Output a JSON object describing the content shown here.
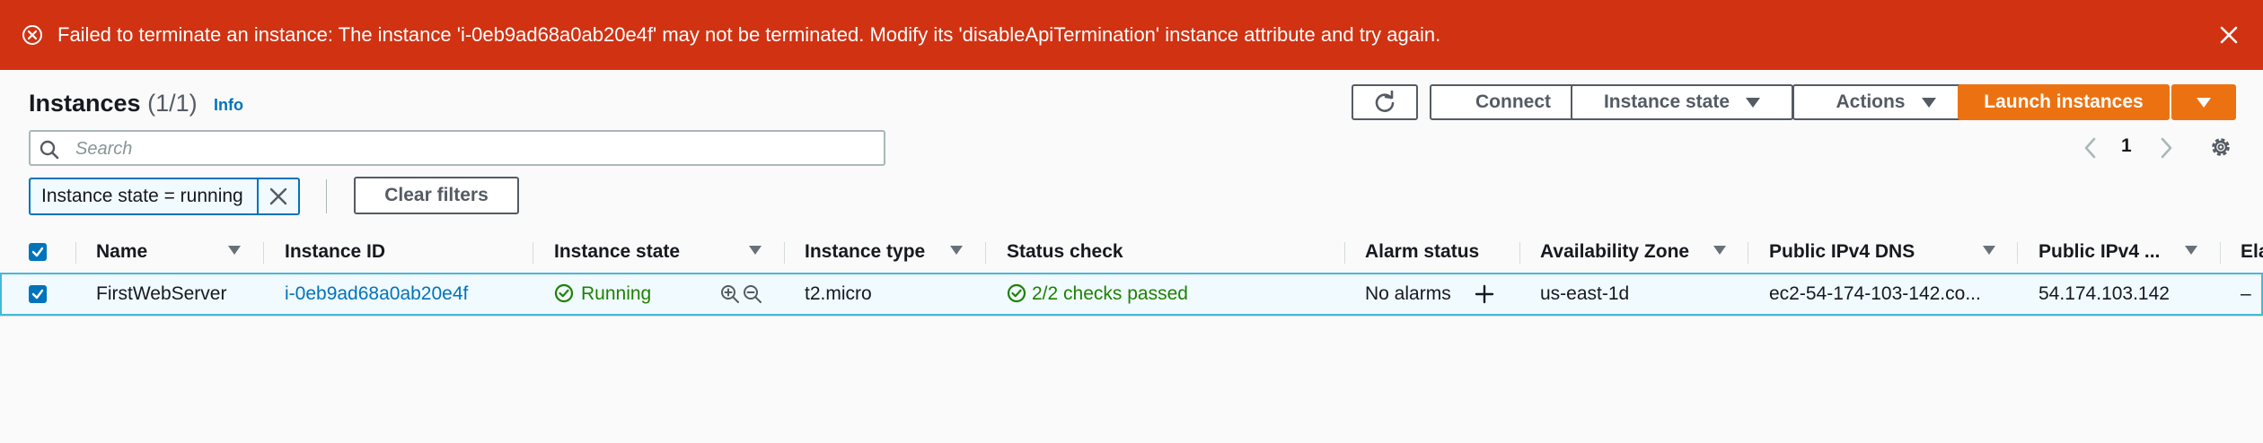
{
  "alert": {
    "message": "Failed to terminate an instance: The instance 'i-0eb9ad68a0ab20e4f' may not be terminated. Modify its 'disableApiTermination' instance attribute and try again.",
    "icon": "error-icon",
    "color": "#d13212"
  },
  "header": {
    "title": "Instances",
    "count": "(1/1)",
    "info": "Info"
  },
  "toolbar": {
    "connect": "Connect",
    "instance_state": "Instance state",
    "actions": "Actions",
    "launch": "Launch instances"
  },
  "search": {
    "placeholder": "Search",
    "value": ""
  },
  "pagination": {
    "page": "1"
  },
  "filters": {
    "token": "Instance state = running",
    "clear": "Clear filters"
  },
  "table": {
    "columns": {
      "name": "Name",
      "instance_id": "Instance ID",
      "instance_state": "Instance state",
      "instance_type": "Instance type",
      "status_check": "Status check",
      "alarm_status": "Alarm status",
      "availability_zone": "Availability Zone",
      "public_dns": "Public IPv4 DNS",
      "public_ip": "Public IPv4 ...",
      "elastic_ip": "Ela"
    },
    "rows": [
      {
        "name": "FirstWebServer",
        "instance_id": "i-0eb9ad68a0ab20e4f",
        "instance_state": "Running",
        "instance_type": "t2.micro",
        "status_check": "2/2 checks passed",
        "alarm_status": "No alarms",
        "availability_zone": "us-east-1d",
        "public_dns": "ec2-54-174-103-142.co...",
        "public_ip": "54.174.103.142",
        "elastic_ip": "–"
      }
    ]
  },
  "colors": {
    "accent": "#0073bb",
    "primary_button": "#ec7211",
    "success": "#1d8102"
  }
}
